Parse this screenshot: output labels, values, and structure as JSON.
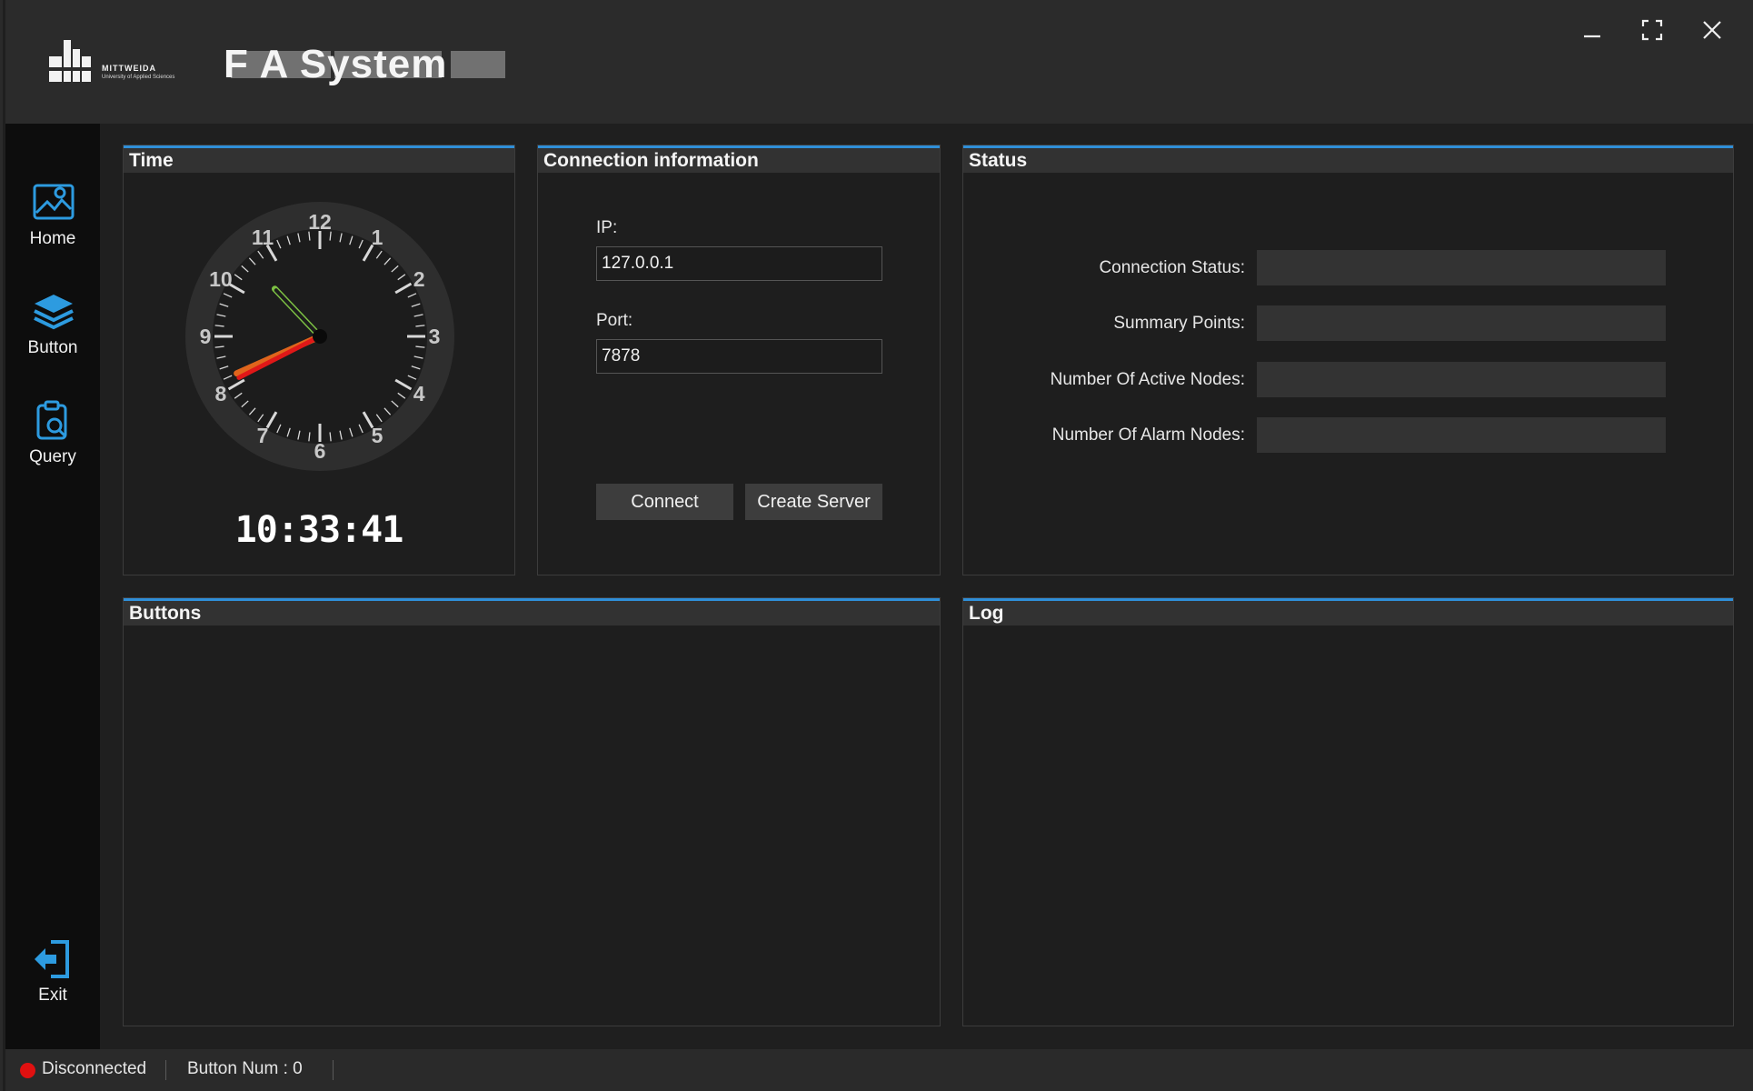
{
  "window": {
    "title": "F A System",
    "logo_text": "MITTWEIDA",
    "logo_subtext": "University of Applied Sciences",
    "controls": {
      "minimize": "minimize-icon",
      "maximize": "maximize-icon",
      "close": "close-icon"
    }
  },
  "sidebar": {
    "items": [
      {
        "label": "Home",
        "icon": "home-map-icon"
      },
      {
        "label": "Button",
        "icon": "layers-icon"
      },
      {
        "label": "Query",
        "icon": "clipboard-search-icon"
      }
    ],
    "exit": {
      "label": "Exit",
      "icon": "exit-icon"
    }
  },
  "time_panel": {
    "title": "Time",
    "clock_numbers": [
      "12",
      "1",
      "2",
      "3",
      "4",
      "5",
      "6",
      "7",
      "8",
      "9",
      "10",
      "11"
    ],
    "digital_time": "10:33:41",
    "colors": {
      "hour_hand": "#e0651c",
      "minute_hand": "#e01818",
      "second_hand": "#7cc043"
    }
  },
  "connection_panel": {
    "title": "Connection information",
    "ip_label": "IP:",
    "ip_value": "127.0.0.1",
    "port_label": "Port:",
    "port_value": "7878",
    "connect_label": "Connect",
    "create_server_label": "Create Server"
  },
  "status_panel": {
    "title": "Status",
    "rows": [
      {
        "label": "Connection Status:",
        "value": ""
      },
      {
        "label": "Summary Points:",
        "value": ""
      },
      {
        "label": "Number Of Active Nodes:",
        "value": ""
      },
      {
        "label": "Number Of Alarm Nodes:",
        "value": ""
      }
    ]
  },
  "buttons_panel": {
    "title": "Buttons"
  },
  "log_panel": {
    "title": "Log"
  },
  "statusbar": {
    "connection": "Disconnected",
    "button_num": "Button Num : 0",
    "colors": {
      "disconnected_dot": "#e01010"
    }
  },
  "theme": {
    "accent": "#2f8fd8",
    "icon_blue": "#2d9be0"
  }
}
